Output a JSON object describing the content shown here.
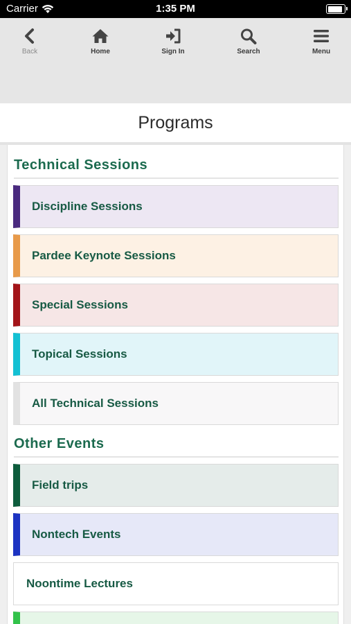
{
  "status_bar": {
    "carrier": "Carrier",
    "time": "1:35 PM"
  },
  "nav": {
    "back": "Back",
    "home": "Home",
    "sign_in": "Sign In",
    "search": "Search",
    "menu": "Menu"
  },
  "page_title": "Programs",
  "sections": [
    {
      "heading": "Technical Sessions",
      "items": [
        {
          "label": "Discipline Sessions",
          "accent": "#4a2a7f",
          "bg": "#ede7f3"
        },
        {
          "label": "Pardee Keynote Sessions",
          "accent": "#e89a4a",
          "bg": "#fdf1e4"
        },
        {
          "label": "Special Sessions",
          "accent": "#a31419",
          "bg": "#f6e6e6"
        },
        {
          "label": "Topical Sessions",
          "accent": "#13c0d3",
          "bg": "#e1f5f9"
        },
        {
          "label": "All Technical Sessions",
          "accent": "#e2e2e2",
          "bg": "#f8f7f8"
        }
      ]
    },
    {
      "heading": "Other Events",
      "items": [
        {
          "label": "Field trips",
          "accent": "#0d5c3c",
          "bg": "#e5ecea"
        },
        {
          "label": "Nontech Events",
          "accent": "#1c33c2",
          "bg": "#e6e8f8"
        },
        {
          "label": "Noontime Lectures",
          "accent": "#d9d9d9",
          "bg": "#ffffff"
        },
        {
          "label": "",
          "accent": "#32c24a",
          "bg": "#e6f6e8"
        }
      ]
    }
  ]
}
